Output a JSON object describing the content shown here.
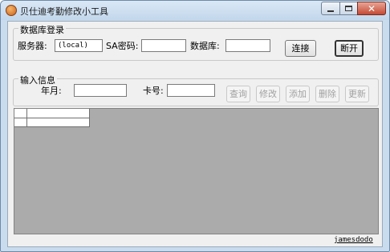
{
  "window": {
    "title": "贝仕迪考勤修改小工具",
    "app_icon": "app-logo-icon",
    "controls": {
      "minimize": "minimize-icon",
      "maximize": "maximize-icon",
      "close": "close-icon"
    }
  },
  "database_login": {
    "group_label": "数据库登录",
    "server_label": "服务器:",
    "server_value": "(local)",
    "sa_password_label": "SA密码:",
    "sa_password_value": "",
    "database_label": "数据库:",
    "database_value": "",
    "connect_button": "连接",
    "disconnect_button": "断开"
  },
  "input_info": {
    "group_label": "输入信息",
    "year_month_label": "年月:",
    "year_month_value": "",
    "card_number_label": "卡号:",
    "card_number_value": "",
    "buttons": {
      "query": "查询",
      "modify": "修改",
      "add": "添加",
      "delete": "删除",
      "update": "更新"
    }
  },
  "footer": {
    "author_link": "jamesdodo"
  },
  "colors": {
    "window_frame": "#c9dcee",
    "client_background": "#f0f0f0",
    "grid_background": "#ababab",
    "close_button": "#c54a34"
  }
}
